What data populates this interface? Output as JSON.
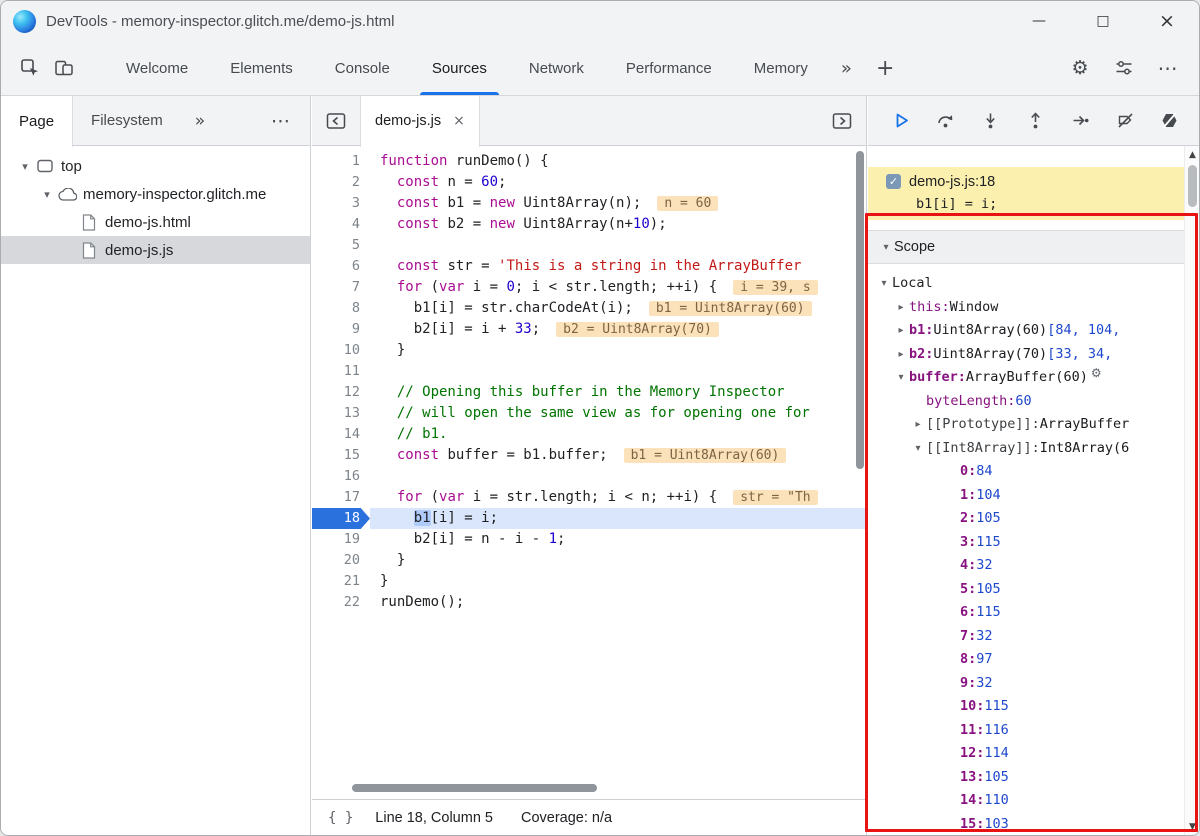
{
  "window": {
    "title": "DevTools - memory-inspector.glitch.me/demo-js.html",
    "controls": {
      "minimize": "—",
      "maximize": "□",
      "close": "×"
    }
  },
  "toolbar": {
    "tabs": [
      "Welcome",
      "Elements",
      "Console",
      "Sources",
      "Network",
      "Performance",
      "Memory"
    ],
    "active_tab": "Sources",
    "overflow": "»",
    "add": "+",
    "more": "⋯"
  },
  "sidebar": {
    "tabs": [
      {
        "label": "Page",
        "active": true
      },
      {
        "label": "Filesystem",
        "active": false
      }
    ],
    "overflow": "»",
    "more": "⋯",
    "tree": [
      {
        "label": "top",
        "level": 0,
        "icon": "frame",
        "expander": "expanded",
        "selected": false
      },
      {
        "label": "memory-inspector.glitch.me",
        "level": 1,
        "icon": "cloud",
        "expander": "expanded",
        "selected": false
      },
      {
        "label": "demo-js.html",
        "level": 2,
        "icon": "file",
        "expander": "none",
        "selected": false
      },
      {
        "label": "demo-js.js",
        "level": 2,
        "icon": "file",
        "expander": "none",
        "selected": true
      }
    ]
  },
  "editor": {
    "tab_label": "demo-js.js",
    "close": "×",
    "status": {
      "braces": "{ }",
      "position": "Line 18, Column 5",
      "coverage": "Coverage: n/a"
    },
    "lines": [
      {
        "no": 1,
        "current": false,
        "tokens": [
          [
            "k",
            "function"
          ],
          [
            "d",
            " runDemo() {"
          ]
        ]
      },
      {
        "no": 2,
        "current": false,
        "tokens": [
          [
            "d",
            "  "
          ],
          [
            "k",
            "const"
          ],
          [
            "d",
            " n = "
          ],
          [
            "n",
            "60"
          ],
          [
            "d",
            ";"
          ]
        ]
      },
      {
        "no": 3,
        "current": false,
        "tokens": [
          [
            "d",
            "  "
          ],
          [
            "k",
            "const"
          ],
          [
            "d",
            " b1 = "
          ],
          [
            "k",
            "new"
          ],
          [
            "d",
            " Uint8Array(n);"
          ],
          [
            "hint",
            "n = 60"
          ]
        ]
      },
      {
        "no": 4,
        "current": false,
        "tokens": [
          [
            "d",
            "  "
          ],
          [
            "k",
            "const"
          ],
          [
            "d",
            " b2 = "
          ],
          [
            "k",
            "new"
          ],
          [
            "d",
            " Uint8Array(n+"
          ],
          [
            "n",
            "10"
          ],
          [
            "d",
            ");"
          ]
        ]
      },
      {
        "no": 5,
        "current": false,
        "tokens": []
      },
      {
        "no": 6,
        "current": false,
        "tokens": [
          [
            "d",
            "  "
          ],
          [
            "k",
            "const"
          ],
          [
            "d",
            " str = "
          ],
          [
            "s",
            "'This is a string in the ArrayBuffer"
          ]
        ]
      },
      {
        "no": 7,
        "current": false,
        "tokens": [
          [
            "d",
            "  "
          ],
          [
            "k",
            "for"
          ],
          [
            "d",
            " ("
          ],
          [
            "k",
            "var"
          ],
          [
            "d",
            " i = "
          ],
          [
            "n",
            "0"
          ],
          [
            "d",
            "; i < str.length; ++i) {"
          ],
          [
            "hint",
            "i = 39, s"
          ]
        ]
      },
      {
        "no": 8,
        "current": false,
        "tokens": [
          [
            "d",
            "    b1[i] = str.charCodeAt(i);"
          ],
          [
            "hint",
            "b1 = Uint8Array(60)"
          ]
        ]
      },
      {
        "no": 9,
        "current": false,
        "tokens": [
          [
            "d",
            "    b2[i] = i + "
          ],
          [
            "n",
            "33"
          ],
          [
            "d",
            ";"
          ],
          [
            "hint",
            "b2 = Uint8Array(70)"
          ]
        ]
      },
      {
        "no": 10,
        "current": false,
        "tokens": [
          [
            "d",
            "  }"
          ]
        ]
      },
      {
        "no": 11,
        "current": false,
        "tokens": []
      },
      {
        "no": 12,
        "current": false,
        "tokens": [
          [
            "c",
            "  // Opening this buffer in the Memory Inspector"
          ]
        ]
      },
      {
        "no": 13,
        "current": false,
        "tokens": [
          [
            "c",
            "  // will open the same view as for opening one for"
          ]
        ]
      },
      {
        "no": 14,
        "current": false,
        "tokens": [
          [
            "c",
            "  // b1."
          ]
        ]
      },
      {
        "no": 15,
        "current": false,
        "tokens": [
          [
            "d",
            "  "
          ],
          [
            "k",
            "const"
          ],
          [
            "d",
            " buffer = b1.buffer;"
          ],
          [
            "hint",
            "b1 = Uint8Array(60)"
          ]
        ]
      },
      {
        "no": 16,
        "current": false,
        "tokens": []
      },
      {
        "no": 17,
        "current": false,
        "tokens": [
          [
            "d",
            "  "
          ],
          [
            "k",
            "for"
          ],
          [
            "d",
            " ("
          ],
          [
            "k",
            "var"
          ],
          [
            "d",
            " i = str.length; i < n; ++i) {"
          ],
          [
            "hint",
            "str = \"Th"
          ]
        ]
      },
      {
        "no": 18,
        "current": true,
        "tokens": [
          [
            "d",
            "    "
          ],
          [
            "sel",
            "b1"
          ],
          [
            "d",
            "[i] = i;"
          ]
        ]
      },
      {
        "no": 19,
        "current": false,
        "tokens": [
          [
            "d",
            "    b2[i] = n - i - "
          ],
          [
            "n",
            "1"
          ],
          [
            "d",
            ";"
          ]
        ]
      },
      {
        "no": 20,
        "current": false,
        "tokens": [
          [
            "d",
            "  }"
          ]
        ]
      },
      {
        "no": 21,
        "current": false,
        "tokens": [
          [
            "d",
            "}"
          ]
        ]
      },
      {
        "no": 22,
        "current": false,
        "tokens": [
          [
            "d",
            "runDemo();"
          ]
        ]
      }
    ]
  },
  "debugger": {
    "breakpoint": {
      "location": "demo-js.js:18",
      "code": "b1[i] = i;",
      "checked": true,
      "check_glyph": "✓"
    },
    "scope": {
      "title": "Scope",
      "rows": [
        {
          "indent": 0,
          "arrow": "expanded",
          "name": "Local",
          "style": "section",
          "value": []
        },
        {
          "indent": 1,
          "arrow": "collapsed",
          "name": "this",
          "style": "prop",
          "value": [
            [
              "obj",
              "Window"
            ]
          ]
        },
        {
          "indent": 1,
          "arrow": "collapsed",
          "name": "b1",
          "style": "prop-bold",
          "value": [
            [
              "obj",
              "Uint8Array(60) "
            ],
            [
              "num",
              "[84, 104,"
            ]
          ]
        },
        {
          "indent": 1,
          "arrow": "collapsed",
          "name": "b2",
          "style": "prop-bold",
          "value": [
            [
              "obj",
              "Uint8Array(70) "
            ],
            [
              "num",
              "[33, 34,"
            ]
          ]
        },
        {
          "indent": 1,
          "arrow": "expanded",
          "name": "buffer",
          "style": "prop-bold",
          "value": [
            [
              "obj",
              "ArrayBuffer(60)"
            ]
          ],
          "suffix_icon": "memory-inspector-icon",
          "suffix_glyph": "⚙"
        },
        {
          "indent": 2,
          "arrow": "none",
          "name": "byteLength",
          "style": "prop",
          "value": [
            [
              "num",
              "60"
            ]
          ]
        },
        {
          "indent": 2,
          "arrow": "collapsed",
          "name": "[[Prototype]]",
          "style": "internal",
          "value": [
            [
              "obj",
              "ArrayBuffer"
            ]
          ]
        },
        {
          "indent": 2,
          "arrow": "expanded",
          "name": "[[Int8Array]]",
          "style": "internal",
          "value": [
            [
              "obj",
              "Int8Array(6"
            ]
          ]
        },
        {
          "indent": 4,
          "arrow": "none",
          "name": "0",
          "style": "index",
          "value": [
            [
              "num",
              "84"
            ]
          ]
        },
        {
          "indent": 4,
          "arrow": "none",
          "name": "1",
          "style": "index",
          "value": [
            [
              "num",
              "104"
            ]
          ]
        },
        {
          "indent": 4,
          "arrow": "none",
          "name": "2",
          "style": "index",
          "value": [
            [
              "num",
              "105"
            ]
          ]
        },
        {
          "indent": 4,
          "arrow": "none",
          "name": "3",
          "style": "index",
          "value": [
            [
              "num",
              "115"
            ]
          ]
        },
        {
          "indent": 4,
          "arrow": "none",
          "name": "4",
          "style": "index",
          "value": [
            [
              "num",
              "32"
            ]
          ]
        },
        {
          "indent": 4,
          "arrow": "none",
          "name": "5",
          "style": "index",
          "value": [
            [
              "num",
              "105"
            ]
          ]
        },
        {
          "indent": 4,
          "arrow": "none",
          "name": "6",
          "style": "index",
          "value": [
            [
              "num",
              "115"
            ]
          ]
        },
        {
          "indent": 4,
          "arrow": "none",
          "name": "7",
          "style": "index",
          "value": [
            [
              "num",
              "32"
            ]
          ]
        },
        {
          "indent": 4,
          "arrow": "none",
          "name": "8",
          "style": "index",
          "value": [
            [
              "num",
              "97"
            ]
          ]
        },
        {
          "indent": 4,
          "arrow": "none",
          "name": "9",
          "style": "index",
          "value": [
            [
              "num",
              "32"
            ]
          ]
        },
        {
          "indent": 4,
          "arrow": "none",
          "name": "10",
          "style": "index",
          "value": [
            [
              "num",
              "115"
            ]
          ]
        },
        {
          "indent": 4,
          "arrow": "none",
          "name": "11",
          "style": "index",
          "value": [
            [
              "num",
              "116"
            ]
          ]
        },
        {
          "indent": 4,
          "arrow": "none",
          "name": "12",
          "style": "index",
          "value": [
            [
              "num",
              "114"
            ]
          ]
        },
        {
          "indent": 4,
          "arrow": "none",
          "name": "13",
          "style": "index",
          "value": [
            [
              "num",
              "105"
            ]
          ]
        },
        {
          "indent": 4,
          "arrow": "none",
          "name": "14",
          "style": "index",
          "value": [
            [
              "num",
              "110"
            ]
          ]
        },
        {
          "indent": 4,
          "arrow": "none",
          "name": "15",
          "style": "index",
          "value": [
            [
              "num",
              "103"
            ]
          ]
        }
      ]
    }
  }
}
